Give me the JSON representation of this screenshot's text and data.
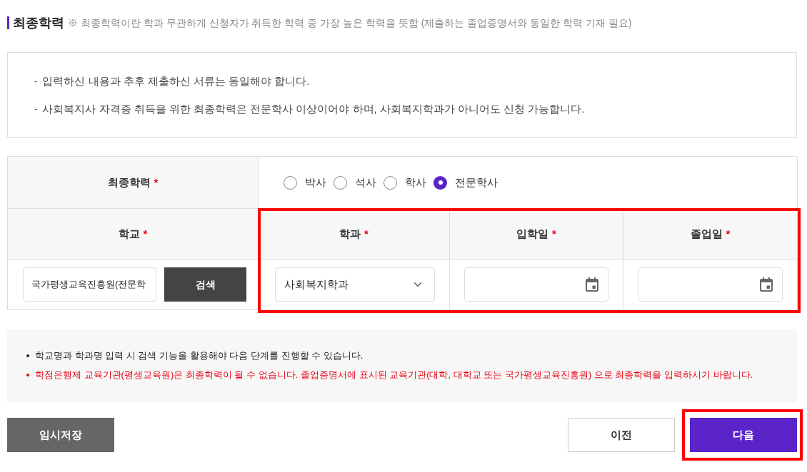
{
  "header": {
    "title": "최종학력",
    "note": "※ 최종학력이란 학과 무관하게 신청자가 취득한 학력 중 가장 높은 학력을 뜻함 (제출하는 졸업증명서와 동일한 학력 기재 필요)"
  },
  "notice": [
    {
      "marker": "-",
      "text": "입력하신 내용과 추후 제출하신 서류는 동일해야 합니다."
    },
    {
      "marker": "-",
      "text": "사회복지사 자격증 취득을 위한 최종학력은 전문학사 이상이어야 하며, 사회복지학과가 아니어도 신청 가능합니다."
    }
  ],
  "education": {
    "label": "최종학력",
    "required_mark": "*",
    "options": [
      {
        "label": "박사",
        "selected": false
      },
      {
        "label": "석사",
        "selected": false
      },
      {
        "label": "학사",
        "selected": false
      },
      {
        "label": "전문학사",
        "selected": true
      }
    ]
  },
  "school": {
    "label": "학교",
    "required_mark": "*",
    "value": "국가평생교육진흥원(전문학",
    "search_button": "검색"
  },
  "details": {
    "highlighted": true,
    "department": {
      "label": "학과",
      "required_mark": "*",
      "value": "사회복지학과"
    },
    "admission_date": {
      "label": "입학일",
      "required_mark": "*"
    },
    "graduation_date": {
      "label": "졸업일",
      "required_mark": "*"
    }
  },
  "guide": [
    {
      "kind": "normal",
      "text": "학교명과 학과명 입력 시 검색 기능을 활용해야 다음 단계를 진행할 수 있습니다."
    },
    {
      "kind": "warning",
      "text": "학점은행제 교육기관(평생교육원)은 최종학력이 될 수 없습니다. 졸업증명서에 표시된 교육기관(대학, 대학교 또는 국가평생교육진흥원) 으로 최종학력을 입력하시기 바랍니다."
    }
  ],
  "actions": [
    {
      "kind": "save",
      "label": "임시저장",
      "highlighted": false
    },
    {
      "kind": "prev",
      "label": "이전",
      "highlighted": false
    },
    {
      "kind": "next",
      "label": "다음",
      "highlighted": true
    }
  ]
}
